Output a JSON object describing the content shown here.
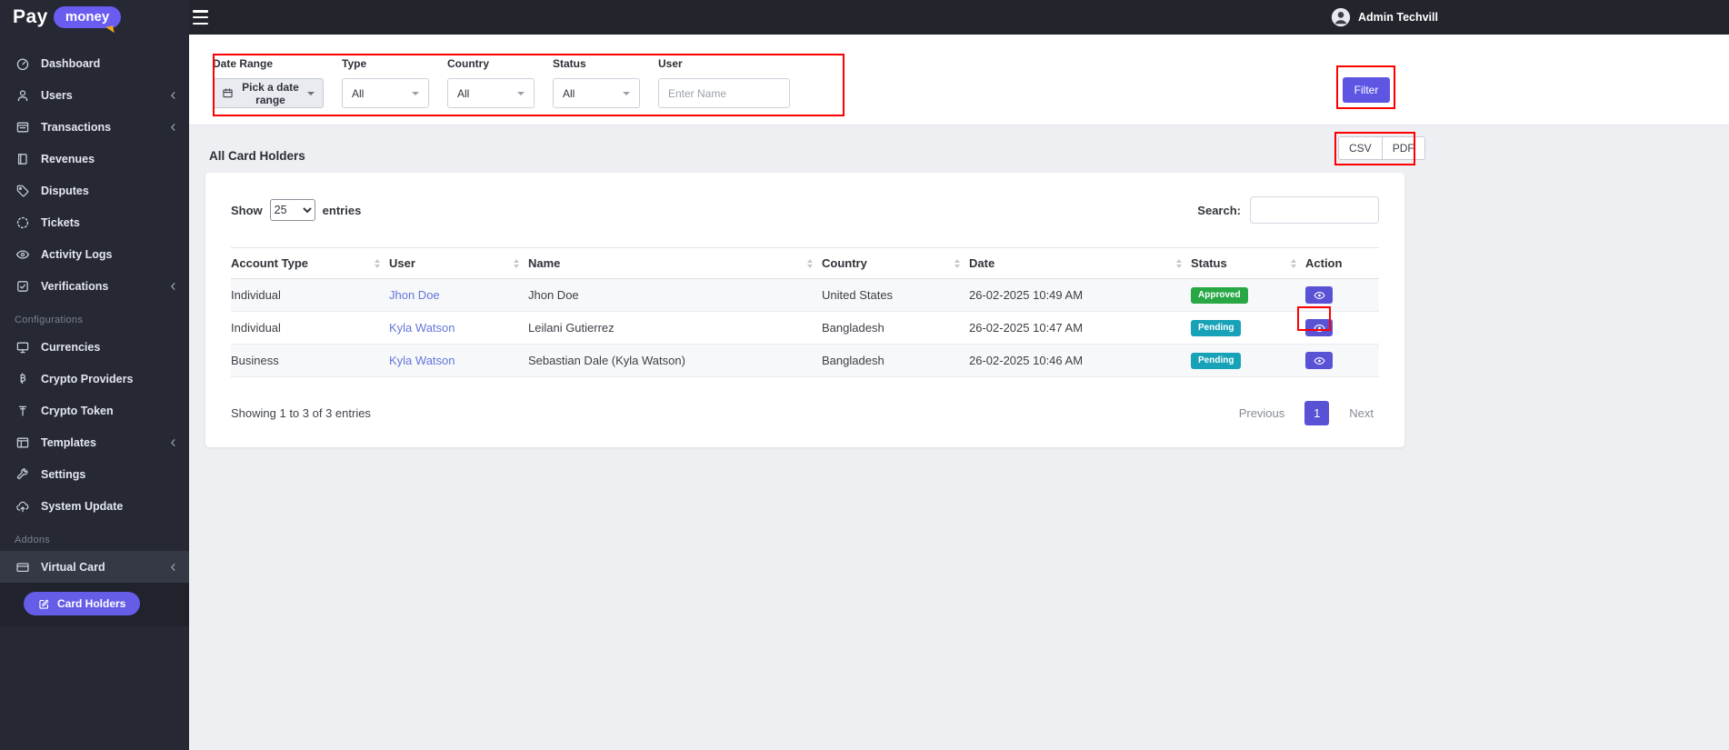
{
  "colors": {
    "accent": "#5f55e3",
    "sidebar_bg": "#262933",
    "topbar_bg": "#23252d",
    "link": "#6476d9",
    "annotation": "#fe0000",
    "badge_approved": "#28a745",
    "badge_pending": "#17a2b8",
    "logo_tail": "#f0a818"
  },
  "topbar": {
    "logo_part1": "Pay",
    "logo_part2": "money",
    "admin_name": "Admin Techvill"
  },
  "sidebar": {
    "sections": {
      "configurations": "Configurations",
      "addons": "Addons"
    },
    "items": {
      "dashboard": "Dashboard",
      "users": "Users",
      "transactions": "Transactions",
      "revenues": "Revenues",
      "disputes": "Disputes",
      "tickets": "Tickets",
      "activity_logs": "Activity Logs",
      "verifications": "Verifications",
      "currencies": "Currencies",
      "crypto_providers": "Crypto Providers",
      "crypto_token": "Crypto Token",
      "templates": "Templates",
      "settings": "Settings",
      "system_update": "System Update",
      "virtual_card": "Virtual Card",
      "card_holders": "Card Holders"
    }
  },
  "filters": {
    "date_range": {
      "label": "Date Range",
      "value": "Pick a date range"
    },
    "type": {
      "label": "Type",
      "value": "All"
    },
    "country": {
      "label": "Country",
      "value": "All"
    },
    "status": {
      "label": "Status",
      "value": "All"
    },
    "user": {
      "label": "User",
      "placeholder": "Enter Name"
    },
    "submit_label": "Filter"
  },
  "page": {
    "title": "All Card Holders",
    "export_csv": "CSV",
    "export_pdf": "PDF"
  },
  "table": {
    "length_menu": {
      "show_label": "Show",
      "selected": "25",
      "entries_label": "entries"
    },
    "search_label": "Search:",
    "columns": [
      "Account Type",
      "User",
      "Name",
      "Country",
      "Date",
      "Status",
      "Action"
    ],
    "rows": [
      {
        "account_type": "Individual",
        "user": "Jhon Doe",
        "name": "Jhon Doe",
        "country": "United States",
        "date": "26-02-2025 10:49 AM",
        "status": "Approved",
        "status_color": "#28a745"
      },
      {
        "account_type": "Individual",
        "user": "Kyla Watson",
        "name": "Leilani Gutierrez",
        "country": "Bangladesh",
        "date": "26-02-2025 10:47 AM",
        "status": "Pending",
        "status_color": "#17a2b8"
      },
      {
        "account_type": "Business",
        "user": "Kyla Watson",
        "name": "Sebastian Dale (Kyla Watson)",
        "country": "Bangladesh",
        "date": "26-02-2025 10:46 AM",
        "status": "Pending",
        "status_color": "#17a2b8"
      }
    ],
    "info": "Showing 1 to 3 of 3 entries",
    "pagination": {
      "previous": "Previous",
      "current": "1",
      "next": "Next"
    }
  }
}
